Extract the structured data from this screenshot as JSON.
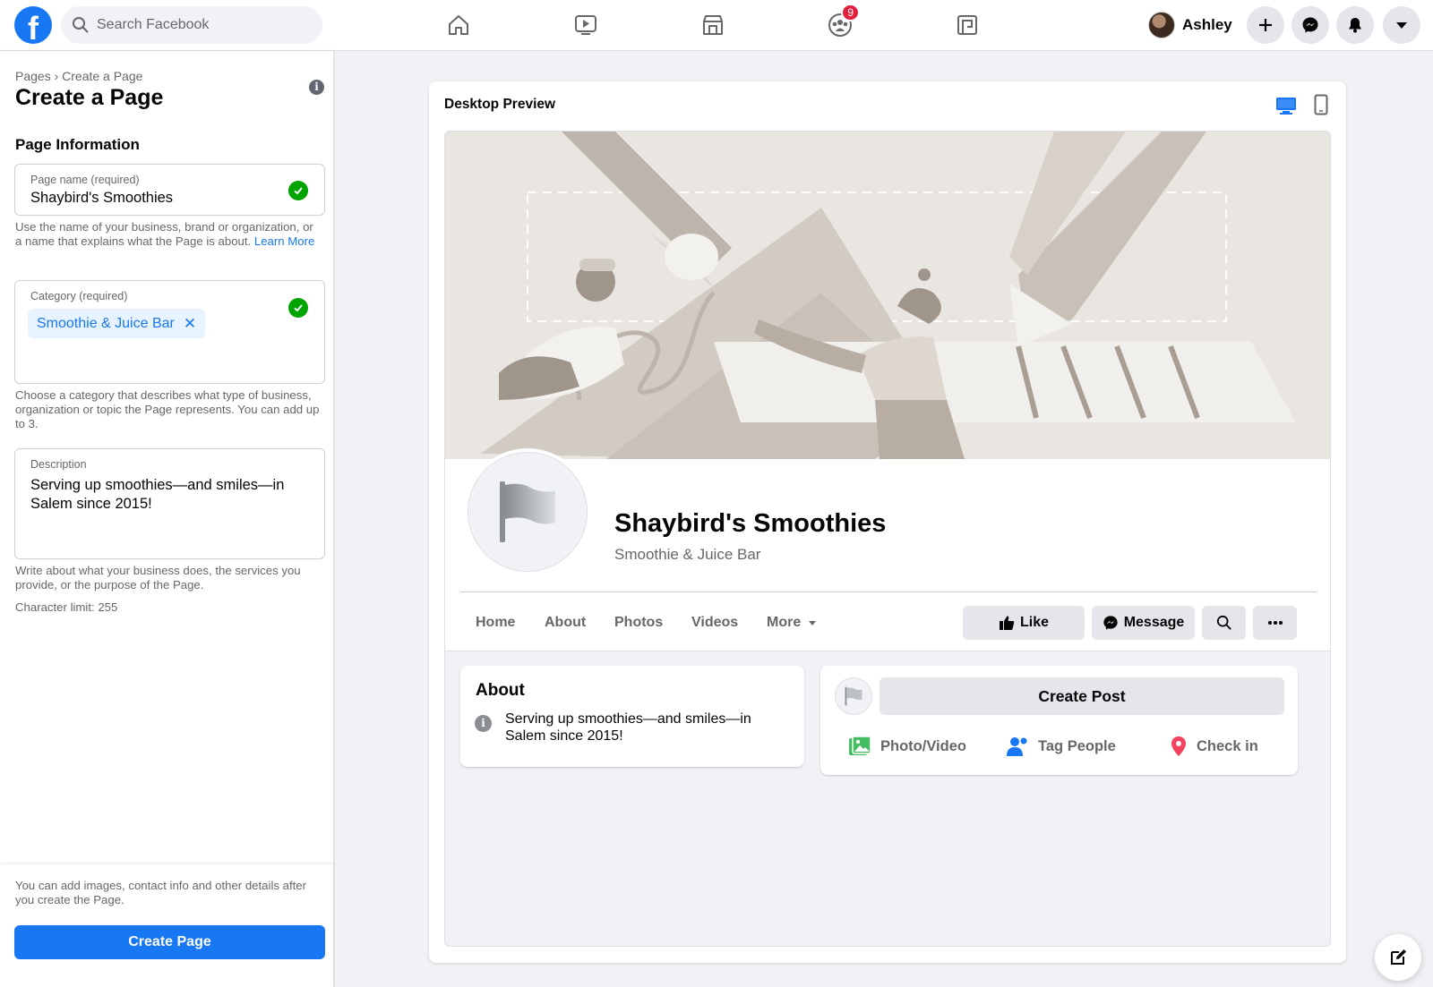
{
  "topnav": {
    "search_placeholder": "Search Facebook",
    "notification_count": "9",
    "profile_name": "Ashley",
    "nav_icons": [
      "home-icon",
      "watch-icon",
      "marketplace-icon",
      "groups-icon",
      "gaming-icon"
    ],
    "right_icons": [
      "plus-icon",
      "messenger-icon",
      "bell-icon",
      "caret-down-icon"
    ]
  },
  "left": {
    "breadcrumb": "Pages › Create a Page",
    "title": "Create a Page",
    "section_title": "Page Information",
    "page_name": {
      "label": "Page name (required)",
      "value": "Shaybird's Smoothies",
      "helper": "Use the name of your business, brand or organization, or a name that explains what the Page is about.",
      "helper_link": "Learn More"
    },
    "category": {
      "label": "Category (required)",
      "chip": "Smoothie & Juice Bar",
      "helper": "Choose a category that describes what type of business, organization or topic the Page represents. You can add up to 3."
    },
    "description": {
      "label": "Description",
      "value": "Serving up smoothies—and smiles—in Salem since 2015!",
      "helper": "Write about what your business does, the services you provide, or the purpose of the Page.",
      "char_limit": "Character limit: 255"
    },
    "footer_note": "You can add images, contact info and other details after you create the Page.",
    "create_button": "Create Page"
  },
  "preview": {
    "title": "Desktop Preview",
    "page_name": "Shaybird's Smoothies",
    "page_category": "Smoothie & Juice Bar",
    "tabs": [
      "Home",
      "About",
      "Photos",
      "Videos",
      "More"
    ],
    "actions": {
      "like": "Like",
      "message": "Message"
    },
    "about": {
      "title": "About",
      "text": "Serving up smoothies—and smiles—in Salem since 2015!"
    },
    "post": {
      "create_post": "Create Post",
      "photo_video": "Photo/Video",
      "tag_people": "Tag People",
      "check_in": "Check in"
    }
  },
  "colors": {
    "brand": "#1877f2",
    "success": "#00a400",
    "badge": "#e41e3f",
    "cover_bg": "#e9e6e2"
  }
}
